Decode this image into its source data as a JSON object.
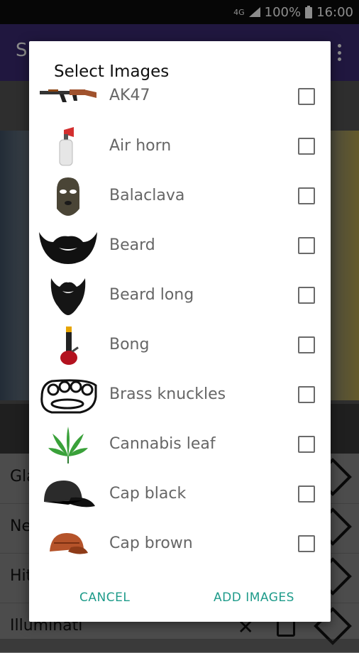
{
  "status_bar": {
    "network": "4G",
    "battery": "100%",
    "time": "16:00"
  },
  "app_bar": {
    "title_partial": "S"
  },
  "background_list": {
    "rows": [
      {
        "label": "Gla"
      },
      {
        "label": "Ne"
      },
      {
        "label": "Hit"
      },
      {
        "label": "Illuminati"
      }
    ]
  },
  "dialog": {
    "title": "Select Images",
    "items": [
      {
        "label": "AK47",
        "icon": "ak47-icon"
      },
      {
        "label": "Air horn",
        "icon": "air-horn-icon"
      },
      {
        "label": "Balaclava",
        "icon": "balaclava-icon"
      },
      {
        "label": "Beard",
        "icon": "beard-icon"
      },
      {
        "label": "Beard long",
        "icon": "beard-long-icon"
      },
      {
        "label": "Bong",
        "icon": "bong-icon"
      },
      {
        "label": "Brass knuckles",
        "icon": "brass-knuckles-icon"
      },
      {
        "label": "Cannabis leaf",
        "icon": "cannabis-leaf-icon"
      },
      {
        "label": "Cap black",
        "icon": "cap-black-icon"
      },
      {
        "label": "Cap brown",
        "icon": "cap-brown-icon"
      }
    ],
    "cancel_label": "CANCEL",
    "add_label": "ADD IMAGES"
  },
  "colors": {
    "accent": "#1e9b8a",
    "app_bar": "#3b2a73"
  }
}
